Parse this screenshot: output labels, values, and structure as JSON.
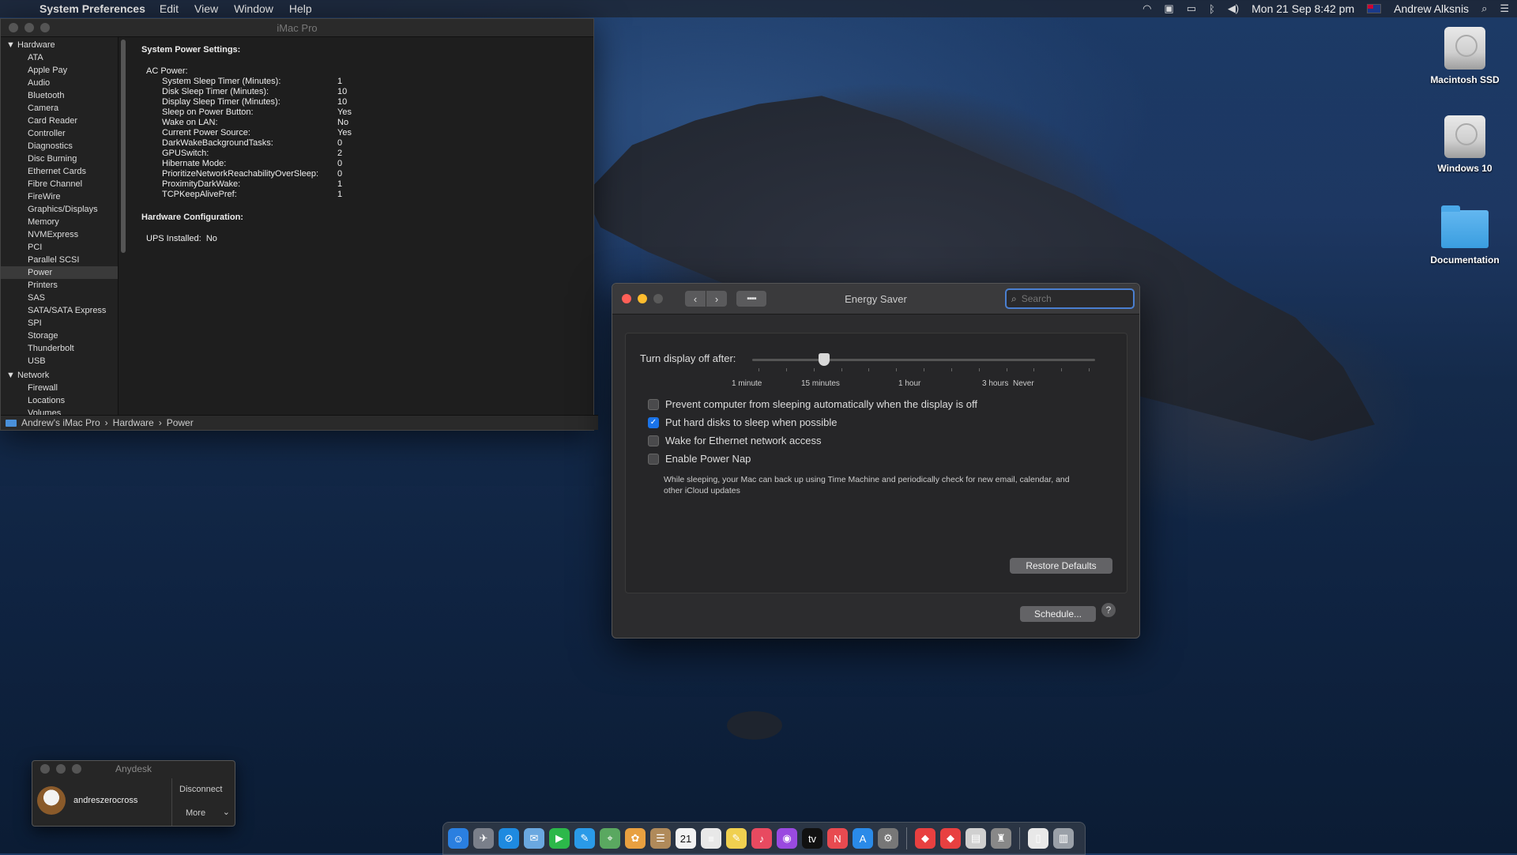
{
  "menubar": {
    "app": "System Preferences",
    "items": [
      "Edit",
      "View",
      "Window",
      "Help"
    ],
    "datetime": "Mon 21 Sep  8:42 pm",
    "user": "Andrew Alksnis"
  },
  "desktop_icons": [
    "Macintosh SSD",
    "Windows 10",
    "Documentation"
  ],
  "sysinfo": {
    "title": "iMac Pro",
    "sidebar": {
      "hardware_label": "Hardware",
      "hardware_items": [
        "ATA",
        "Apple Pay",
        "Audio",
        "Bluetooth",
        "Camera",
        "Card Reader",
        "Controller",
        "Diagnostics",
        "Disc Burning",
        "Ethernet Cards",
        "Fibre Channel",
        "FireWire",
        "Graphics/Displays",
        "Memory",
        "NVMExpress",
        "PCI",
        "Parallel SCSI",
        "Power",
        "Printers",
        "SAS",
        "SATA/SATA Express",
        "SPI",
        "Storage",
        "Thunderbolt",
        "USB"
      ],
      "selected": "Power",
      "network_label": "Network",
      "network_items": [
        "Firewall",
        "Locations",
        "Volumes"
      ]
    },
    "content": {
      "heading1": "System Power Settings:",
      "ac_power": "AC Power:",
      "settings": [
        {
          "k": "System Sleep Timer (Minutes):",
          "v": "1"
        },
        {
          "k": "Disk Sleep Timer (Minutes):",
          "v": "10"
        },
        {
          "k": "Display Sleep Timer (Minutes):",
          "v": "10"
        },
        {
          "k": "Sleep on Power Button:",
          "v": "Yes"
        },
        {
          "k": "Wake on LAN:",
          "v": "No"
        },
        {
          "k": "Current Power Source:",
          "v": "Yes"
        },
        {
          "k": "DarkWakeBackgroundTasks:",
          "v": "0"
        },
        {
          "k": "GPUSwitch:",
          "v": "2"
        },
        {
          "k": "Hibernate Mode:",
          "v": "0"
        },
        {
          "k": "PrioritizeNetworkReachabilityOverSleep:",
          "v": "0"
        },
        {
          "k": "ProximityDarkWake:",
          "v": "1"
        },
        {
          "k": "TCPKeepAlivePref:",
          "v": "1"
        }
      ],
      "heading2": "Hardware Configuration:",
      "ups_label": "UPS Installed:",
      "ups_value": "No"
    },
    "path": [
      "Andrew's iMac Pro",
      "Hardware",
      "Power"
    ],
    "path_sep": "›"
  },
  "energy": {
    "title": "Energy Saver",
    "search_placeholder": "Search",
    "slider_label": "Turn display off after:",
    "slider_value_fraction": 0.21,
    "tick_labels": [
      "1 minute",
      "15 minutes",
      "1 hour",
      "3 hours",
      "Never"
    ],
    "checkboxes": [
      {
        "label": "Prevent computer from sleeping automatically when the display is off",
        "checked": false
      },
      {
        "label": "Put hard disks to sleep when possible",
        "checked": true
      },
      {
        "label": "Wake for Ethernet network access",
        "checked": false
      },
      {
        "label": "Enable Power Nap",
        "checked": false
      }
    ],
    "power_nap_note": "While sleeping, your Mac can back up using Time Machine and periodically check for new email, calendar, and other iCloud updates",
    "restore_defaults": "Restore Defaults",
    "schedule": "Schedule...",
    "help": "?"
  },
  "anydesk": {
    "title": "Anydesk",
    "user": "andreszerocross",
    "disconnect": "Disconnect",
    "more": "More"
  },
  "dock": {
    "icons": [
      "finder-icon",
      "launchpad-icon",
      "safari-icon",
      "mail-icon",
      "facetime-icon",
      "messages-icon",
      "maps-icon",
      "photos-icon",
      "contacts-icon",
      "calendar-icon",
      "reminders-icon",
      "notes-icon",
      "music-icon",
      "podcasts-icon",
      "tv-icon",
      "news-icon",
      "app-store-icon",
      "system-preferences-icon",
      "anydesk-icon",
      "anydesk-alt-icon",
      "preview-icon",
      "automator-icon",
      "document-icon",
      "trash-icon"
    ],
    "calendar_day": "21"
  }
}
